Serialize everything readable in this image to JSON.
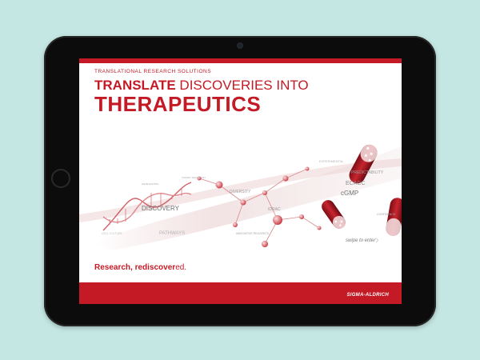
{
  "colors": {
    "background": "#c5e7e3",
    "brand_red": "#c41a25",
    "bezel": "#0c0c0c"
  },
  "screen": {
    "subtitle": "TRANSLATIONAL RESEARCH SOLUTIONS",
    "headline": {
      "bold_word": "TRANSLATE",
      "rest": "DISCOVERIES INTO",
      "line2": "THERAPEUTICS"
    },
    "art_labels": [
      "DISCOVERY",
      "PATHWAYS",
      "DIVERSITY",
      "ECACC",
      "cGMP",
      "PREDICTABILITY",
      "EXPERIMENTAL",
      "CONFIDENCE",
      "INNOVATIVE REAGENTS",
      "IDRAC",
      "TARGET SELECTION",
      "GENE EDITING",
      "CELL CULTURE"
    ],
    "swipe_hint": "swipe to enter",
    "swipe_chevron": "›",
    "tagline": {
      "bold": "Research, re",
      "bold2": "discover",
      "regular": "ed."
    },
    "logo": "SIGMA-ALDRICH"
  }
}
